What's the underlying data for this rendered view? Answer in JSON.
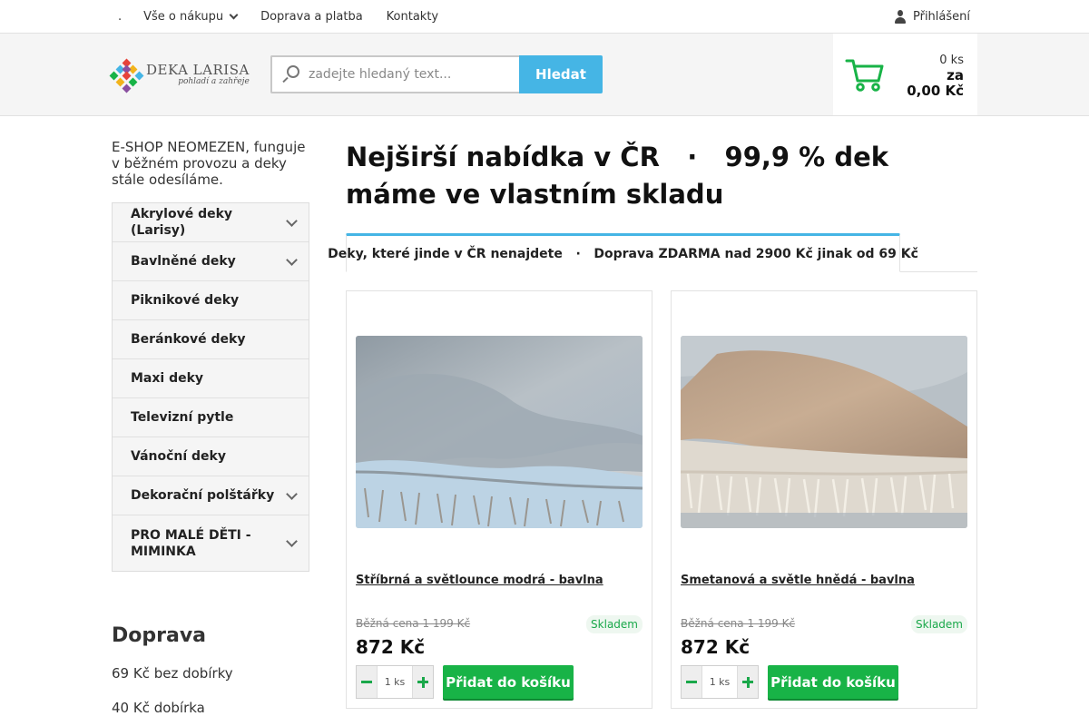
{
  "topnav": {
    "dot": ".",
    "items": [
      {
        "label": "Vše o nákupu",
        "has_dropdown": true
      },
      {
        "label": "Doprava a platba"
      },
      {
        "label": "Kontakty"
      }
    ],
    "login": "Přihlášení",
    "login_icon": "user-icon"
  },
  "header": {
    "logo_name": "DEKA LARISA",
    "logo_tagline": "pohladí a zahřeje",
    "search": {
      "placeholder": "zadejte hledaný text...",
      "value": "",
      "button": "Hledat",
      "icon": "search-icon"
    },
    "cart": {
      "count": "0 ks",
      "za": "za",
      "total": "0,00 Kč",
      "icon": "cart-icon",
      "color": "#18b347"
    }
  },
  "sidebar": {
    "notice": "E-SHOP NEOMEZEN, funguje v běžném provozu a deky stále odesíláme.",
    "categories": [
      {
        "label": "Akrylové deky (Larisy)",
        "expandable": true
      },
      {
        "label": "Bavlněné deky",
        "expandable": true
      },
      {
        "label": "Piknikové deky",
        "expandable": false
      },
      {
        "label": "Beránkové deky",
        "expandable": false
      },
      {
        "label": "Maxi deky",
        "expandable": false
      },
      {
        "label": "Televizní pytle",
        "expandable": false
      },
      {
        "label": "Vánoční deky",
        "expandable": false
      },
      {
        "label": "Dekorační polštářky",
        "expandable": true
      },
      {
        "label": "PRO MALÉ DĚTI - MIMINKA",
        "expandable": true
      }
    ],
    "shipping_heading": "Doprava",
    "shipping_lines": [
      "69 Kč bez dobírky",
      "40 Kč dobírka"
    ]
  },
  "main": {
    "title": "Nejširší nabídka v ČR   ·   99,9 % dek máme ve vlastním skladu",
    "tab": "Deky, které jinde v ČR nenajdete   ·   Doprava ZDARMA nad 2900 Kč jinak od 69 Kč",
    "products": [
      {
        "title": "Stříbrná a světlounce modrá - bavlna",
        "old_price": "Běžná cena 1 199 Kč",
        "price": "872 Kč",
        "stock": "Skladem",
        "qty": "1 ks",
        "add": "Přidat do košíku"
      },
      {
        "title": "Smetanová a světle hnědá - bavlna",
        "old_price": "Běžná cena 1 199 Kč",
        "price": "872 Kč",
        "stock": "Skladem",
        "qty": "1 ks",
        "add": "Přidat do košíku"
      }
    ]
  },
  "colors": {
    "accent": "#45b5e5",
    "buy": "#18b347",
    "stock": "#1aa84a"
  }
}
